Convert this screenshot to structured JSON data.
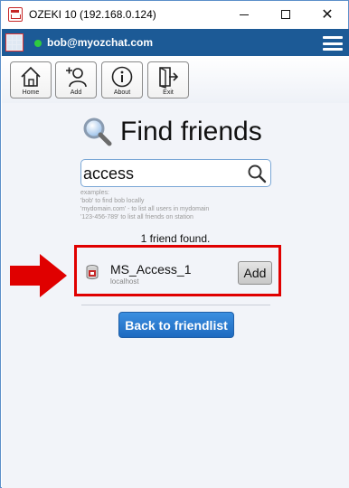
{
  "window": {
    "title": "OZEKI 10 (192.168.0.124)"
  },
  "header": {
    "user": "bob@myozchat.com",
    "status_color": "#2ecc40",
    "bar_color": "#1c5a96"
  },
  "toolbar": {
    "buttons": [
      {
        "label": "Home",
        "icon": "home-icon"
      },
      {
        "label": "Add",
        "icon": "add-user-icon"
      },
      {
        "label": "About",
        "icon": "info-icon"
      },
      {
        "label": "Exit",
        "icon": "exit-icon"
      }
    ]
  },
  "main": {
    "title": "Find friends",
    "search": {
      "value": "access",
      "placeholder": ""
    },
    "examples": [
      "examples:",
      "'bob' to find bob locally",
      "'mydomain.com' - to list all users in mydomain",
      "'123-456-789' to list all friends on station"
    ],
    "found_count": "1 friend found.",
    "results": [
      {
        "name": "MS_Access_1",
        "host": "localhost",
        "action": "Add"
      }
    ],
    "back_button": "Back to friendlist",
    "highlight_color": "#e00000"
  }
}
